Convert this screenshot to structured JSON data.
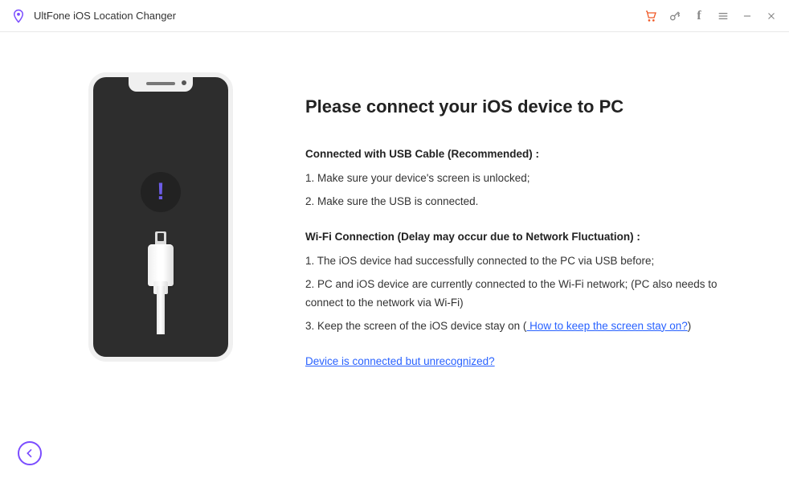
{
  "app": {
    "title": "UltFone iOS Location Changer"
  },
  "titlebar": {
    "cart": "cart-icon",
    "key": "key-icon",
    "facebook": "f",
    "menu": "menu-icon",
    "minimize": "minimize-icon",
    "close": "close-icon"
  },
  "main": {
    "heading": "Please connect your iOS device to PC",
    "usb": {
      "title": "Connected with USB Cable (Recommended) :",
      "step1": "1. Make sure your device's screen is unlocked;",
      "step2": "2. Make sure the USB is connected."
    },
    "wifi": {
      "title": "Wi-Fi Connection (Delay may occur due to Network Fluctuation) :",
      "step1": "1. The iOS device had successfully connected to the PC via USB before;",
      "step2": "2. PC and iOS device are currently connected to the Wi-Fi network; (PC also needs to connect to the network via Wi-Fi)",
      "step3_prefix": "3. Keep the screen of the iOS device stay on  (",
      "step3_link": " How to keep the screen stay on?",
      "step3_suffix": ")"
    },
    "unrecognized_link": "Device is connected but unrecognized?"
  }
}
